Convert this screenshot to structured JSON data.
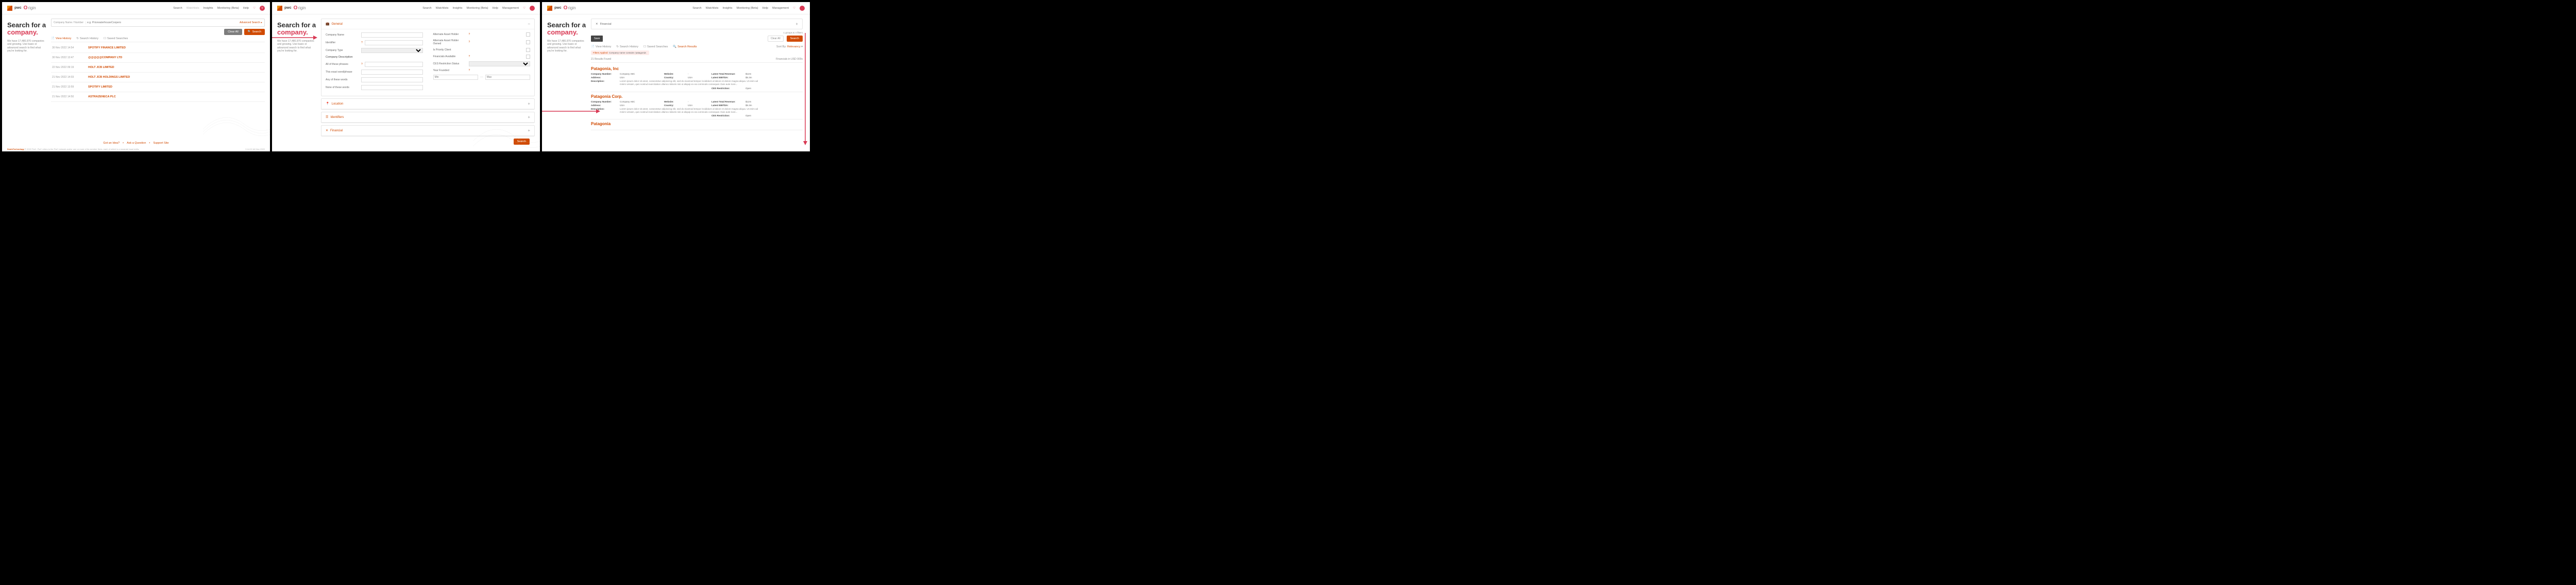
{
  "brand": {
    "pwc": "pwc",
    "origin_o": "O",
    "origin_rest": "rigin"
  },
  "nav": {
    "items": [
      "Search",
      "Watchlists",
      "Insights",
      "Monitoring (Beta)",
      "Help",
      "Management"
    ],
    "avatar": "V"
  },
  "hero": {
    "line1": "Search for a",
    "line2": "company",
    "dot": ".",
    "sub": "We have 17,480,970 companies and growing. Use basic or advanced search to find what you're looking for."
  },
  "screen1": {
    "search_label": "Company Name / Number",
    "placeholder": "e.g. PricewaterhouseCoopers",
    "advanced": "Advanced Search",
    "clear_all": "Clear All",
    "search_btn": "Search",
    "tabs": {
      "view_history": "View History",
      "search_history": "Search History",
      "saved_searches": "Saved Searches"
    },
    "history": [
      {
        "date": "30 Nov 2022 14:54",
        "company": "SPOTIFY FINANCE LIMITED"
      },
      {
        "date": "30 Nov 2022 13:47",
        "company": "@@@@@COMPANY LTD"
      },
      {
        "date": "22 Nov 2022 09:19",
        "company": "HOLT JCB LIMITED"
      },
      {
        "date": "21 Nov 2022 14:03",
        "company": "HOLT JCB HOLDINGS LIMITED"
      },
      {
        "date": "21 Nov 2022 13:59",
        "company": "SPOTIFY LIMITED"
      },
      {
        "date": "21 Nov 2022 14:50",
        "company": "ASTRAZENECA PLC"
      }
    ],
    "footer": {
      "idea": "Got an Idea?",
      "ask": "Ask a Question",
      "support": "Support Site"
    },
    "legal": {
      "dt": "DealsTechnology",
      "copy": "© 2022 PwC. PwC refers to the PwC network and/or one or more of its member firms, each of which is a separate legal entity.",
      "stamp": "0.14.20 &6 Nov 2022"
    }
  },
  "screen2": {
    "panels": {
      "general": "General",
      "location": "Location",
      "identifiers": "Identifiers",
      "financial": "Financial"
    },
    "fields": {
      "company_name": "Company Name",
      "identifier": "Identifier",
      "company_type": "Company Type",
      "alt_holder": "Alternate Asset Holder",
      "alt_holder_owned": "Alternate Asset Holder Owned",
      "priority": "Is Priority Client",
      "financials_avail": "Financials Available",
      "ces": "CES Restriction Status",
      "year_founded": "Year Founded",
      "min": "Min",
      "max": "Max"
    },
    "desc_title": "Company Description",
    "desc_fields": {
      "all": "All of these phrases",
      "exact": "This exact word/phrase",
      "any": "Any of these words",
      "none": "None of these words"
    },
    "search_btn": "Search"
  },
  "screen3": {
    "filter_label": "Financial",
    "groups_note": "1 groups & 4 filters",
    "save": "Save",
    "clear_all": "Clear All",
    "search": "Search",
    "tabs": {
      "view_history": "View History",
      "search_history": "Search History",
      "saved": "Saved Searches",
      "results": "Search Results"
    },
    "sort_label": "Sort By:",
    "sort_value": "Relevancy",
    "filters_applied_label": "Filters Applied:",
    "filters_applied_value": "Company name contains 'patagonia'.",
    "results_found": "21 Results Found",
    "currency": "Financials in USD 000s",
    "cards": [
      {
        "title": "Patagonia, Inc",
        "company": "Company ABC",
        "address": "USA",
        "website": "-",
        "country": "USA",
        "revenue": "$12m",
        "ebitda": "$5.3m",
        "ces": "Open",
        "desc": "Lorem ipsum dolor sit amet, consectetur adipiscing elit, sed do eiusmod tempor incididunt ut labore et dolore magna aliqua. Ut enim ad minim veniam, quis nostrud exercitation ullamco laboris nisi ut aliquip ex ea commodo consequat. Duis aute irure..."
      },
      {
        "title": "Patagonia Corp.",
        "company": "Company ABC",
        "address": "USA",
        "website": "-",
        "country": "USA",
        "revenue": "$12m",
        "ebitda": "$5.3m",
        "ces": "Open",
        "desc": "Lorem ipsum dolor sit amet, consectetur adipiscing elit, sed do eiusmod tempor incididunt ut labore et dolore magna aliqua. Ut enim ad minim veniam, quis nostrud exercitation ullamco laboris nisi ut aliquip ex ea commodo consequat. Duis aute irure..."
      },
      {
        "title": "Patagonia"
      }
    ],
    "labels": {
      "company": "Company Number:",
      "address": "Address:",
      "desc": "Description:",
      "website": "Website:",
      "country": "Country:",
      "revenue": "Latest Total Revenue:",
      "ebitda": "Latest EBITDA:",
      "ces": "CES Restriction:"
    }
  }
}
